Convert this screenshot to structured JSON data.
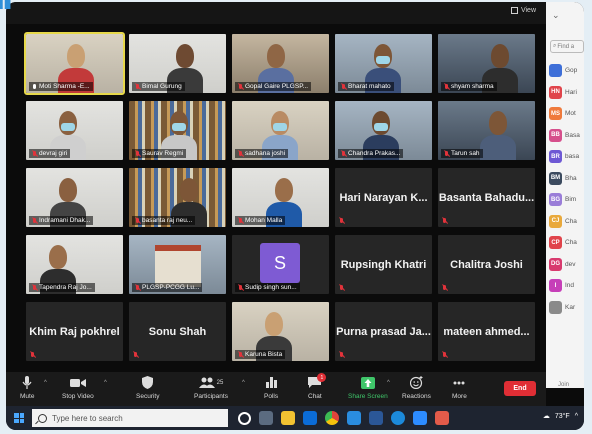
{
  "window": {
    "view_label": "View"
  },
  "gallery": {
    "tiles": [
      {
        "name": "Moti Sharma -E...",
        "mic": "on"
      },
      {
        "name": "Bimal Gurung"
      },
      {
        "name": "Gopal Gaire PLGSP..."
      },
      {
        "name": "Bharat mahato"
      },
      {
        "name": "shyam sharma"
      },
      {
        "name": "devraj giri"
      },
      {
        "name": "Saurav Regmi"
      },
      {
        "name": "sadhana joshi"
      },
      {
        "name": "Chandra Prakas..."
      },
      {
        "name": "Tarun sah"
      },
      {
        "name": "Indramani Dhak..."
      },
      {
        "name": "basanta raj neu..."
      },
      {
        "name": "Mohan Malla"
      },
      {
        "name": "Hari Narayan K..."
      },
      {
        "name": "Basanta Bahadu..."
      },
      {
        "name": "Tapendra Raj Jo..."
      },
      {
        "name": "PLGSP-PCGG Lu..."
      },
      {
        "name": "Sudip singh sun...",
        "avatar_letter": "S"
      },
      {
        "name": "Rupsingh Khatri"
      },
      {
        "name": "Chalitra Joshi"
      },
      {
        "name": "Khim Raj pokhrel"
      },
      {
        "name": "Sonu Shah"
      },
      {
        "name": "Karuna Bista"
      },
      {
        "name": "Purna prasad Ja..."
      },
      {
        "name": "mateen ahmed..."
      }
    ]
  },
  "sidebar": {
    "find_placeholder": "Find a",
    "participants": [
      {
        "initials": "",
        "name": "Gop",
        "color": "#3e6fd8"
      },
      {
        "initials": "HN",
        "name": "Hari",
        "color": "#e0444b"
      },
      {
        "initials": "MS",
        "name": "Mot",
        "color": "#ef7a3c"
      },
      {
        "initials": "BB",
        "name": "Basa",
        "color": "#d64f8c"
      },
      {
        "initials": "BR",
        "name": "basa",
        "color": "#6d58d4"
      },
      {
        "initials": "BM",
        "name": "Bha",
        "color": "#3b4a5e"
      },
      {
        "initials": "BG",
        "name": "Bim",
        "color": "#9a7dd8"
      },
      {
        "initials": "CJ",
        "name": "Cha",
        "color": "#e9a93c"
      },
      {
        "initials": "CP",
        "name": "Cha",
        "color": "#e0444b"
      },
      {
        "initials": "DG",
        "name": "dev",
        "color": "#d83a6e"
      },
      {
        "initials": "I",
        "name": "Ind",
        "color": "#c63fb8"
      },
      {
        "initials": "",
        "name": "Kar",
        "color": "#8a8a8a"
      }
    ],
    "footer": "Join"
  },
  "toolbar": {
    "mute": "Mute",
    "stop_video": "Stop Video",
    "security": "Security",
    "participants": "Participants",
    "participants_count": "25",
    "polls": "Polls",
    "chat": "Chat",
    "chat_badge": "1",
    "share_screen": "Share Screen",
    "reactions": "Reactions",
    "more": "More",
    "end": "End"
  },
  "taskbar": {
    "search_placeholder": "Type here to search",
    "weather": "73°F"
  }
}
